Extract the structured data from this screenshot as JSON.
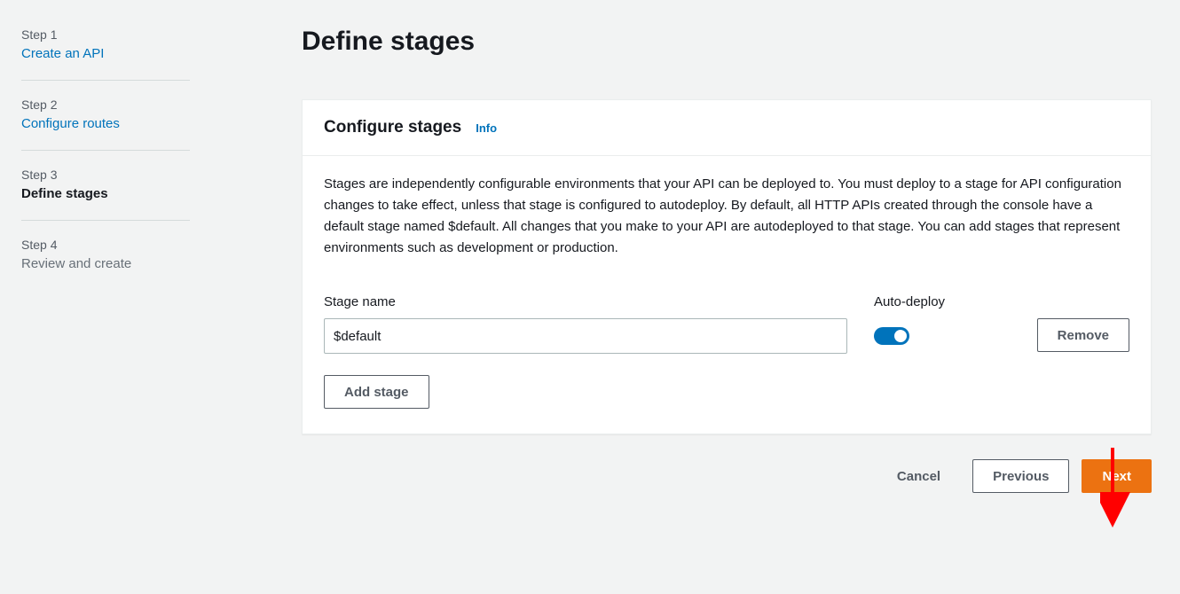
{
  "sidebar": {
    "steps": [
      {
        "num": "Step 1",
        "title": "Create an API",
        "state": "link"
      },
      {
        "num": "Step 2",
        "title": "Configure routes",
        "state": "link"
      },
      {
        "num": "Step 3",
        "title": "Define stages",
        "state": "active"
      },
      {
        "num": "Step 4",
        "title": "Review and create",
        "state": "inactive"
      }
    ]
  },
  "page": {
    "title": "Define stages"
  },
  "panel": {
    "heading": "Configure stages",
    "info": "Info",
    "description": "Stages are independently configurable environments that your API can be deployed to. You must deploy to a stage for API configuration changes to take effect, unless that stage is configured to autodeploy. By default, all HTTP APIs created through the console have a default stage named $default. All changes that you make to your API are autodeployed to that stage. You can add stages that represent environments such as development or production.",
    "fields": {
      "name": {
        "label": "Stage name",
        "value": "$default"
      },
      "auto_deploy": {
        "label": "Auto-deploy",
        "on": true
      }
    },
    "remove_label": "Remove",
    "add_label": "Add stage"
  },
  "footer": {
    "cancel": "Cancel",
    "previous": "Previous",
    "next": "Next"
  },
  "annotation": {
    "arrow_color": "#ff0000"
  }
}
